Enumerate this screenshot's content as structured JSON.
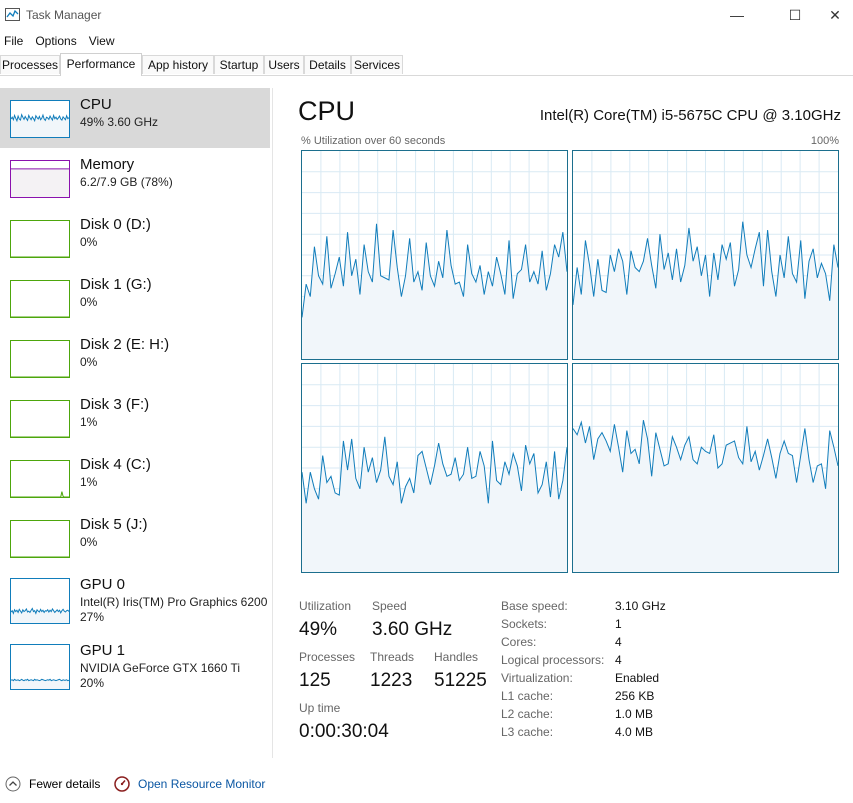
{
  "window": {
    "title": "Task Manager",
    "min_glyph": "—",
    "max_glyph": "☐",
    "close_glyph": "✕"
  },
  "menu": [
    "File",
    "Options",
    "View"
  ],
  "tabs": [
    "Processes",
    "Performance",
    "App history",
    "Startup",
    "Users",
    "Details",
    "Services"
  ],
  "active_tab": "Performance",
  "sidebar": [
    {
      "name": "CPU",
      "sub": "49% 3.60 GHz",
      "color": "#117dbb"
    },
    {
      "name": "Memory",
      "sub": "6.2/7.9 GB (78%)",
      "color": "#8b12ae"
    },
    {
      "name": "Disk 0 (D:)",
      "sub": "0%",
      "color": "#4da60c"
    },
    {
      "name": "Disk 1 (G:)",
      "sub": "0%",
      "color": "#4da60c"
    },
    {
      "name": "Disk 2 (E: H:)",
      "sub": "0%",
      "color": "#4da60c"
    },
    {
      "name": "Disk 3 (F:)",
      "sub": "1%",
      "color": "#4da60c"
    },
    {
      "name": "Disk 4 (C:)",
      "sub": "1%",
      "color": "#4da60c"
    },
    {
      "name": "Disk 5 (J:)",
      "sub": "0%",
      "color": "#4da60c"
    },
    {
      "name": "GPU 0",
      "sub": "Intel(R) Iris(TM) Pro Graphics 6200",
      "sub2": "27%",
      "color": "#117dbb"
    },
    {
      "name": "GPU 1",
      "sub": "NVIDIA GeForce GTX 1660 Ti",
      "sub2": "20%",
      "color": "#117dbb"
    }
  ],
  "main": {
    "title": "CPU",
    "model": "Intel(R) Core(TM) i5-5675C CPU @ 3.10GHz",
    "graph_label": "% Utilization over 60 seconds",
    "graph_max": "100%"
  },
  "stats": {
    "utilization_label": "Utilization",
    "utilization": "49%",
    "speed_label": "Speed",
    "speed": "3.60 GHz",
    "processes_label": "Processes",
    "processes": "125",
    "threads_label": "Threads",
    "threads": "1223",
    "handles_label": "Handles",
    "handles": "51225",
    "uptime_label": "Up time",
    "uptime": "0:00:30:04"
  },
  "info": [
    {
      "label": "Base speed:",
      "value": "3.10 GHz"
    },
    {
      "label": "Sockets:",
      "value": "1"
    },
    {
      "label": "Cores:",
      "value": "4"
    },
    {
      "label": "Logical processors:",
      "value": "4"
    },
    {
      "label": "Virtualization:",
      "value": "Enabled"
    },
    {
      "label": "L1 cache:",
      "value": "256 KB"
    },
    {
      "label": "L2 cache:",
      "value": "1.0 MB"
    },
    {
      "label": "L3 cache:",
      "value": "4.0 MB"
    }
  ],
  "footer": {
    "fewer_details": "Fewer details",
    "resource_monitor": "Open Resource Monitor"
  },
  "core_graphs": [
    [
      20,
      36,
      30,
      54,
      40,
      36,
      59,
      34,
      41,
      49,
      35,
      61,
      40,
      48,
      31,
      55,
      42,
      37,
      65,
      40,
      39,
      38,
      62,
      44,
      30,
      40,
      58,
      37,
      42,
      33,
      56,
      40,
      35,
      47,
      39,
      62,
      45,
      36,
      37,
      30,
      55,
      41,
      37,
      45,
      31,
      42,
      35,
      49,
      41,
      31,
      57,
      29,
      41,
      43,
      55,
      37,
      42,
      36,
      52,
      33,
      41,
      55,
      49,
      61,
      42
    ],
    [
      26,
      44,
      31,
      57,
      45,
      30,
      48,
      33,
      32,
      50,
      42,
      53,
      47,
      31,
      52,
      44,
      42,
      47,
      58,
      45,
      34,
      60,
      43,
      51,
      38,
      53,
      37,
      45,
      63,
      47,
      54,
      40,
      50,
      30,
      51,
      38,
      55,
      48,
      56,
      35,
      43,
      66,
      50,
      44,
      53,
      61,
      35,
      62,
      42,
      30,
      50,
      39,
      59,
      41,
      37,
      57,
      29,
      47,
      53,
      39,
      46,
      41,
      28,
      55,
      44
    ],
    [
      48,
      33,
      48,
      40,
      35,
      56,
      43,
      46,
      38,
      37,
      63,
      49,
      64,
      45,
      40,
      60,
      48,
      55,
      43,
      49,
      65,
      46,
      42,
      53,
      33,
      41,
      45,
      38,
      56,
      58,
      50,
      42,
      51,
      62,
      52,
      46,
      47,
      55,
      44,
      47,
      60,
      45,
      46,
      58,
      51,
      33,
      63,
      44,
      42,
      53,
      47,
      57,
      51,
      39,
      61,
      52,
      57,
      38,
      42,
      53,
      36,
      58,
      35,
      44,
      60
    ],
    [
      69,
      66,
      72,
      62,
      70,
      54,
      64,
      67,
      63,
      58,
      71,
      60,
      48,
      68,
      57,
      59,
      52,
      73,
      64,
      46,
      67,
      59,
      51,
      52,
      65,
      60,
      54,
      61,
      65,
      54,
      52,
      60,
      58,
      57,
      66,
      50,
      52,
      61,
      62,
      63,
      55,
      52,
      70,
      53,
      58,
      49,
      56,
      64,
      55,
      45,
      57,
      63,
      57,
      56,
      43,
      56,
      69,
      54,
      43,
      51,
      52,
      40,
      68,
      60,
      51
    ]
  ],
  "sidebar_graphs": {
    "cpu": [
      50,
      55,
      48,
      60,
      52,
      45,
      58,
      50,
      47,
      62,
      55,
      49,
      57,
      51,
      46,
      60,
      53,
      48,
      56,
      51,
      45,
      59,
      54,
      50,
      57,
      48,
      52,
      61,
      50,
      46,
      55,
      53,
      49,
      58,
      52,
      47,
      60,
      51,
      55,
      49,
      53,
      58,
      50,
      47,
      56,
      52,
      48,
      59,
      51,
      54
    ],
    "memory": [
      78,
      78,
      78,
      78,
      78,
      78,
      78,
      78,
      78,
      78,
      78,
      78,
      78,
      78,
      78,
      78,
      78,
      78,
      78,
      78,
      78,
      78,
      78,
      78,
      78,
      78,
      78,
      78,
      78,
      78,
      78,
      78,
      78,
      78,
      78,
      78,
      78,
      78,
      78,
      78,
      78,
      78,
      78,
      78,
      78,
      78,
      78,
      78,
      78,
      78
    ],
    "disk": [
      0,
      0,
      0,
      0,
      0,
      0,
      0,
      0,
      0,
      0,
      0,
      0,
      0,
      0,
      0,
      0,
      0,
      0,
      0,
      0,
      0,
      0,
      0,
      0,
      0,
      0,
      0,
      0,
      0,
      0,
      0,
      0,
      0,
      0,
      0,
      0,
      0,
      0,
      0,
      0,
      0,
      0,
      0,
      0,
      0,
      0,
      0,
      0,
      0,
      0
    ],
    "disk4": [
      0,
      0,
      0,
      0,
      0,
      0,
      0,
      0,
      0,
      0,
      0,
      0,
      0,
      0,
      0,
      0,
      0,
      0,
      0,
      0,
      0,
      0,
      0,
      0,
      0,
      0,
      0,
      0,
      0,
      0,
      0,
      0,
      0,
      0,
      0,
      0,
      0,
      0,
      0,
      0,
      0,
      0,
      0,
      15,
      2,
      0,
      0,
      0,
      0,
      0
    ],
    "gpu0": [
      25,
      28,
      22,
      30,
      26,
      29,
      24,
      31,
      27,
      23,
      30,
      26,
      28,
      32,
      25,
      27,
      24,
      29,
      33,
      26,
      28,
      22,
      30,
      27,
      25,
      31,
      26,
      29,
      24,
      28,
      27,
      30,
      25,
      29,
      26,
      32,
      28,
      24,
      27,
      30,
      26,
      29,
      23,
      28,
      31,
      27,
      25,
      28,
      29,
      26
    ],
    "gpu1": [
      20,
      21,
      19,
      22,
      20,
      20,
      21,
      19,
      20,
      22,
      20,
      19,
      21,
      20,
      22,
      19,
      20,
      21,
      20,
      19,
      22,
      20,
      21,
      20,
      19,
      20,
      22,
      21,
      20,
      19,
      20,
      21,
      20,
      22,
      19,
      20,
      21,
      20,
      19,
      20,
      21,
      22,
      20,
      19,
      21,
      20,
      20,
      21,
      19,
      20
    ]
  },
  "colors": {
    "cpu_line": "#117dbb",
    "cpu_fill": "#f1f6fa",
    "grid": "#d9eaf4",
    "graph_border": "#1c6f8e",
    "selected": "#d9d9d9",
    "link": "#0b57a3"
  }
}
